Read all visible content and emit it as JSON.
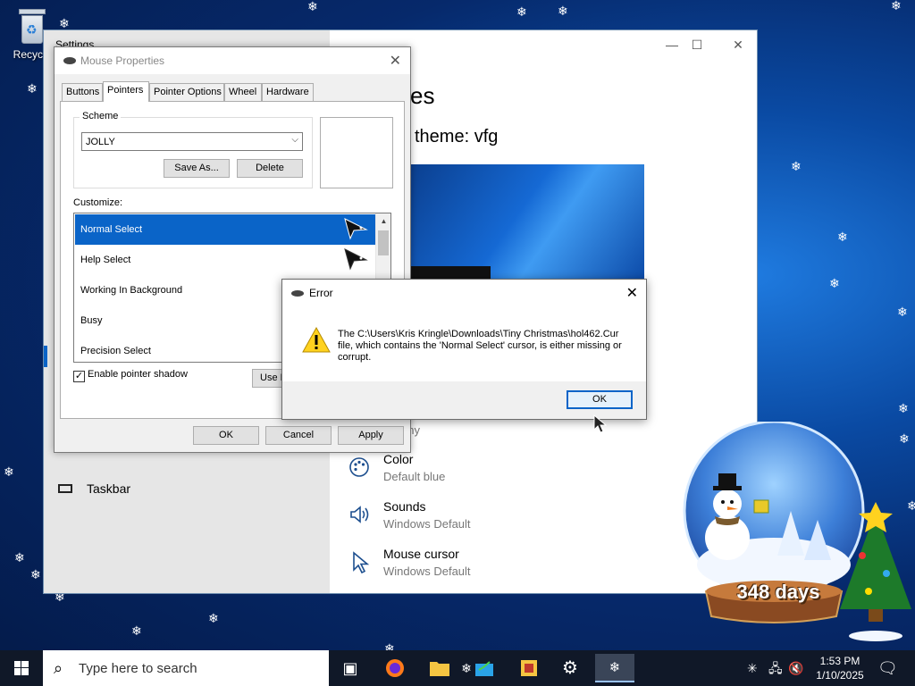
{
  "desktop": {
    "recycle_bin_label": "Recycle"
  },
  "settings": {
    "title": "Settings",
    "heading": "es",
    "current_theme": "theme: vfg",
    "harmony_text": "ony",
    "nav_taskbar": "Taskbar",
    "rows": [
      {
        "name": "Color",
        "value": "Default blue",
        "icon": "palette-icon"
      },
      {
        "name": "Sounds",
        "value": "Windows Default",
        "icon": "speaker-icon"
      },
      {
        "name": "Mouse cursor",
        "value": "Windows Default",
        "icon": "mouse-pointer-icon"
      }
    ]
  },
  "mouse_properties": {
    "title": "Mouse Properties",
    "tabs": [
      "Buttons",
      "Pointers",
      "Pointer Options",
      "Wheel",
      "Hardware"
    ],
    "active_tab": "Pointers",
    "scheme_label": "Scheme",
    "scheme_value": "JOLLY",
    "save_as_label": "Save As...",
    "delete_label": "Delete",
    "customize_label": "Customize:",
    "cursor_items": [
      "Normal Select",
      "Help Select",
      "Working In Background",
      "Busy",
      "Precision Select"
    ],
    "selected_item": "Normal Select",
    "shadow_label": "Enable pointer shadow",
    "shadow_checked": true,
    "use_default_label": "Use D",
    "ok_label": "OK",
    "cancel_label": "Cancel",
    "apply_label": "Apply"
  },
  "error_dialog": {
    "title": "Error",
    "message": "The C:\\Users\\Kris Kringle\\Downloads\\Tiny Christmas\\hol462.Cur file, which contains the 'Normal Select' cursor, is either missing or corrupt.",
    "ok_label": "OK"
  },
  "snow_globe": {
    "countdown": "348 days"
  },
  "taskbar": {
    "search_placeholder": "Type here to search",
    "time": "1:53 PM",
    "date": "1/10/2025"
  },
  "colors": {
    "accent": "#0a64c8",
    "desktop_dark": "#041a48",
    "desktop_light": "#1f7be0",
    "taskbar": "#101828"
  }
}
